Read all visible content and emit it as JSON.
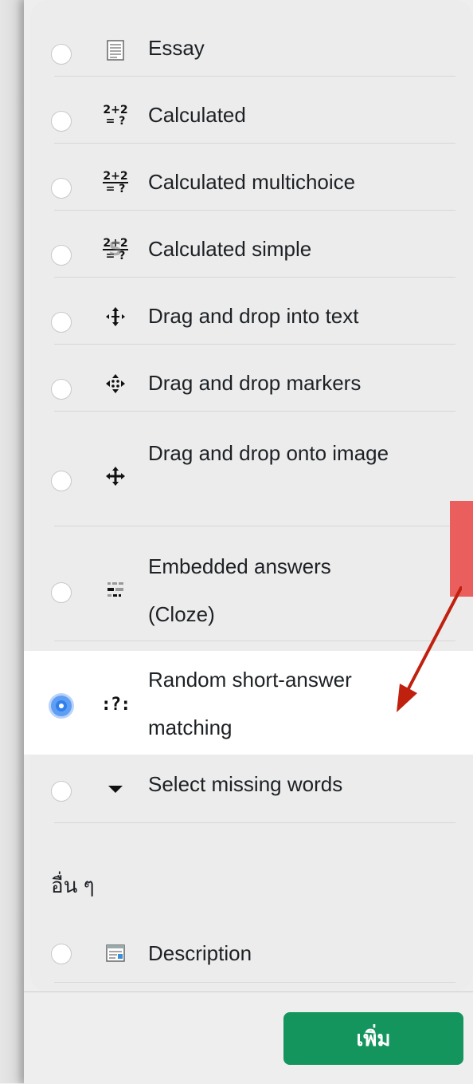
{
  "question_types": [
    {
      "label": "Essay",
      "icon": "essay-icon",
      "selected": false
    },
    {
      "label": "Calculated",
      "icon": "calculated-icon",
      "icon_text": [
        "2+2",
        "= ?"
      ],
      "selected": false
    },
    {
      "label": "Calculated multichoice",
      "icon": "calculated-multichoice-icon",
      "icon_text": [
        "2+2",
        "= ?"
      ],
      "selected": false
    },
    {
      "label": "Calculated simple",
      "icon": "calculated-simple-icon",
      "icon_text": [
        "2+2",
        "= ?"
      ],
      "selected": false
    },
    {
      "label": "Drag and drop into text",
      "icon": "drag-drop-text-icon",
      "selected": false
    },
    {
      "label": "Drag and drop markers",
      "icon": "drag-drop-markers-icon",
      "selected": false
    },
    {
      "label": "Drag and drop onto image",
      "icon": "drag-drop-image-icon",
      "selected": false
    },
    {
      "label": "Embedded answers (Cloze)",
      "icon": "cloze-icon",
      "selected": false
    },
    {
      "label": "Random short-answer matching",
      "icon": "random-short-answer-icon",
      "icon_text": ":?:",
      "selected": true
    },
    {
      "label": "Select missing words",
      "icon": "caret-down-icon",
      "selected": false
    }
  ],
  "other_section": {
    "heading": "อื่น ๆ",
    "items": [
      {
        "label": "Description",
        "icon": "description-icon",
        "selected": false
      }
    ]
  },
  "footer": {
    "add_button_label": "เพิ่ม"
  },
  "colors": {
    "add_button": "#14955e",
    "radio_selected": "#2f80ed",
    "annotation_red": "#eb5e5e",
    "arrow_red": "#c0200e"
  }
}
